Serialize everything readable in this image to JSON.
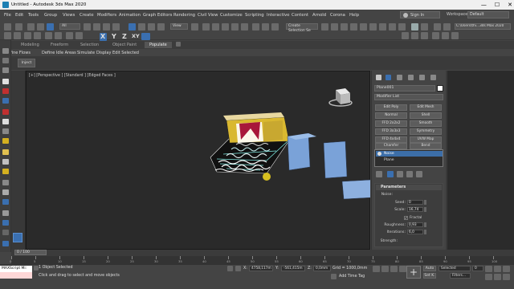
{
  "window": {
    "title": "Untitled - Autodesk 3ds Max 2020",
    "controls": [
      "—",
      "☐",
      "✕"
    ]
  },
  "menu": [
    "File",
    "Edit",
    "Tools",
    "Group",
    "Views",
    "Create",
    "Modifiers",
    "Animation",
    "Graph Editors",
    "Rendering",
    "Civil View",
    "Customize",
    "Scripting",
    "Interactive",
    "Content",
    "Arnold",
    "Corona",
    "Help"
  ],
  "account": {
    "sign_in": "Sign In",
    "workspaces_label": "Workspaces:",
    "workspace": "Default"
  },
  "toolbar": {
    "selection_filter": "All",
    "ref_coord": "View",
    "named_selection": "Create Selection Se",
    "axis_x": "X",
    "axis_y": "Y",
    "axis_z": "Z",
    "axis_xy": "XY",
    "project_path": "C:\\Users\\thi...3ds Max 2020"
  },
  "ribbon": {
    "tabs": [
      "Modeling",
      "Freeform",
      "Selection",
      "Object Paint",
      "Populate"
    ],
    "active_tab": "Populate",
    "sub": [
      "Define Flows",
      "Define Idle Areas",
      "Simulate",
      "Display",
      "Edit Selected"
    ],
    "inject": "Inject"
  },
  "viewport": {
    "label": "[+] [Perspective ] [Standard ] [Edged Faces ]"
  },
  "command_panel": {
    "object_name": "Plane001",
    "modifier_list": "Modifier List",
    "modifier_buttons": [
      "Edit Poly",
      "Edit Mesh",
      "Normal",
      "Shell",
      "FFD 2x2x2",
      "Smooth",
      "FFD 3x3x3",
      "Symmetry",
      "FFD 4x4x4",
      "UVW Map",
      "Chamfer",
      "Bend"
    ],
    "stack": [
      "Noise",
      "Plane"
    ],
    "stack_selected": "Noise",
    "parameters": {
      "header": "Parameters",
      "noise_label": "Noise:",
      "seed_label": "Seed:",
      "seed": "0",
      "scale_label": "Scale:",
      "scale": "16,74",
      "fractal_label": "Fractal",
      "fractal_checked": "✔",
      "roughness_label": "Roughness:",
      "roughness": "0,93",
      "iterations_label": "Iterations:",
      "iterations": "6,0",
      "strength_label": "Strength:"
    }
  },
  "timeline": {
    "frame": "0 / 100",
    "ticks": [
      "0",
      "5",
      "10",
      "15",
      "20",
      "25",
      "30",
      "35",
      "40",
      "45",
      "50",
      "55",
      "60",
      "65",
      "70",
      "75",
      "80",
      "85",
      "90",
      "95",
      "100"
    ]
  },
  "statusbar": {
    "maxscript": "MAXScript Mi:",
    "selected": "1 Object Selected",
    "prompt": "Click and drag to select and move objects",
    "x_label": "X:",
    "x": "4758,117m",
    "y_label": "Y:",
    "y": "-561,415m",
    "z_label": "Z:",
    "z": "0,0mm",
    "grid": "Grid = 1000,0mm",
    "add_time_tag": "Add Time Tag",
    "auto": "Auto",
    "set_key": "Set K.",
    "selected_drop": "Selected",
    "filters": "Filters...",
    "key_frame": "0"
  }
}
